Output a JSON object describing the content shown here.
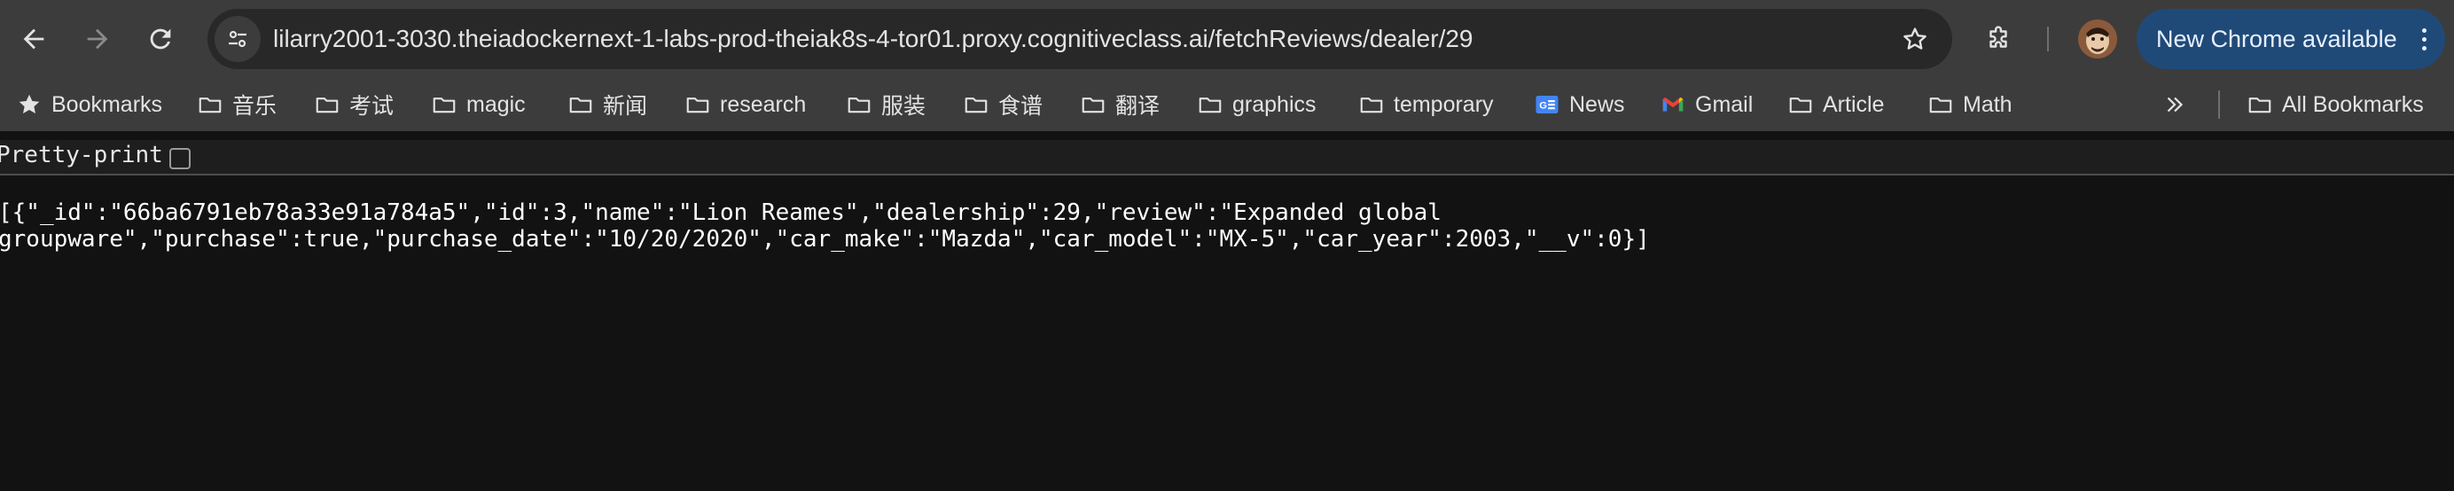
{
  "browser": {
    "url": "lilarry2001-3030.theiadockernext-1-labs-prod-theiak8s-4-tor01.proxy.cognitiveclass.ai/fetchReviews/dealer/29",
    "update_button_label": "New Chrome available",
    "accent_color": "#1f4a78"
  },
  "bookmarks": {
    "items": [
      {
        "label": "Bookmarks",
        "icon": "star-icon"
      },
      {
        "label": "音乐",
        "icon": "folder-icon"
      },
      {
        "label": "考试",
        "icon": "folder-icon"
      },
      {
        "label": "magic",
        "icon": "folder-icon"
      },
      {
        "label": "新闻",
        "icon": "folder-icon"
      },
      {
        "label": "research",
        "icon": "folder-icon"
      },
      {
        "label": "服装",
        "icon": "folder-icon"
      },
      {
        "label": "食谱",
        "icon": "folder-icon"
      },
      {
        "label": "翻译",
        "icon": "folder-icon"
      },
      {
        "label": "graphics",
        "icon": "folder-icon"
      },
      {
        "label": "temporary",
        "icon": "folder-icon"
      },
      {
        "label": "News",
        "icon": "google-news-icon"
      },
      {
        "label": "Gmail",
        "icon": "gmail-icon"
      },
      {
        "label": "Article",
        "icon": "folder-icon"
      },
      {
        "label": "Math",
        "icon": "folder-icon"
      }
    ],
    "overflow_icon": "chevron-double-right-icon",
    "all_bookmarks_label": "All Bookmarks"
  },
  "page": {
    "pretty_print_label": "Pretty-print",
    "pretty_print_checked": false,
    "json_line_1": "[{\"_id\":\"66ba6791eb78a33e91a784a5\",\"id\":3,\"name\":\"Lion Reames\",\"dealership\":29,\"review\":\"Expanded global",
    "json_line_2": "groupware\",\"purchase\":true,\"purchase_date\":\"10/20/2020\",\"car_make\":\"Mazda\",\"car_model\":\"MX-5\",\"car_year\":2003,\"__v\":0}]"
  }
}
